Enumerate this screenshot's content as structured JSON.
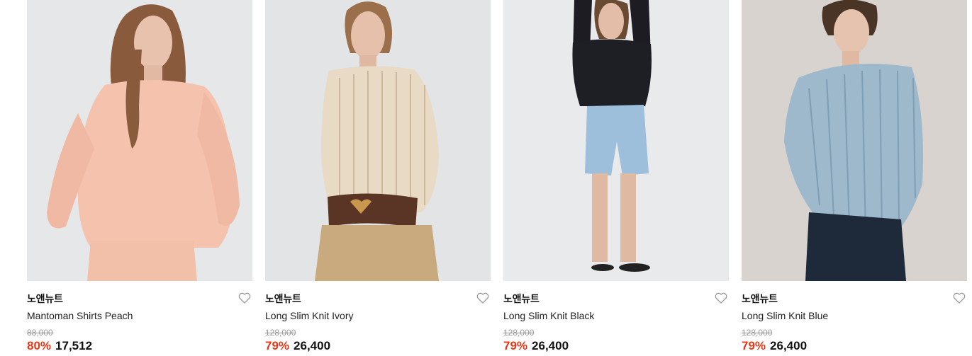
{
  "colors": {
    "discount": "#e5391b"
  },
  "products": [
    {
      "brand": "노앤뉴트",
      "name": "Mantoman Shirts Peach",
      "original_price": "88,000",
      "discount": "80%",
      "price": "17,512",
      "icon": "heart-outline-icon"
    },
    {
      "brand": "노앤뉴트",
      "name": "Long Slim Knit Ivory",
      "original_price": "128,000",
      "discount": "79%",
      "price": "26,400",
      "icon": "heart-outline-icon"
    },
    {
      "brand": "노앤뉴트",
      "name": "Long Slim Knit Black",
      "original_price": "128,000",
      "discount": "79%",
      "price": "26,400",
      "icon": "heart-outline-icon"
    },
    {
      "brand": "노앤뉴트",
      "name": "Long Slim Knit Blue",
      "original_price": "128,000",
      "discount": "79%",
      "price": "26,400",
      "icon": "heart-outline-icon"
    }
  ]
}
